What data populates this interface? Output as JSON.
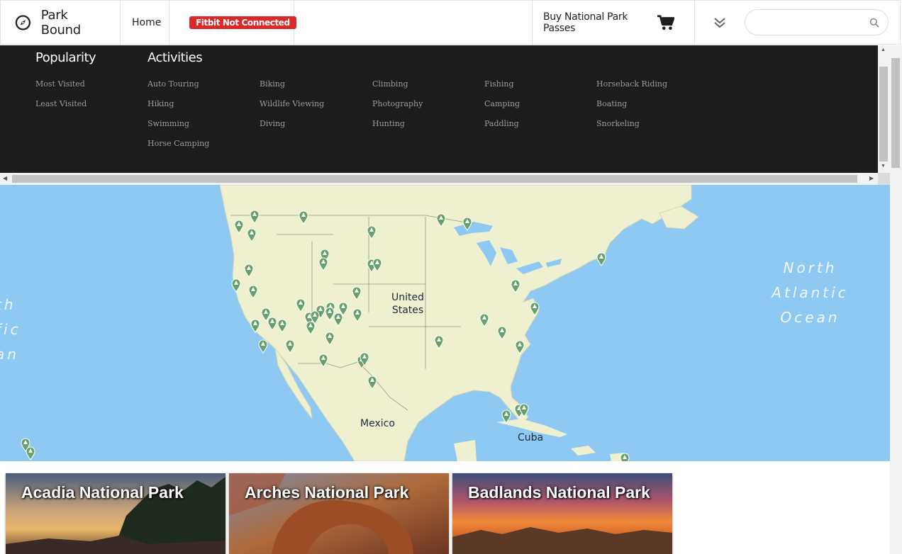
{
  "brand": {
    "name": "Park Bound",
    "logo_icon": "compass-icon"
  },
  "nav": {
    "home": "Home",
    "fitbit_status": "Fitbit Not Connected",
    "passes": "Buy National Park Passes",
    "cart_icon": "shopping-cart-icon",
    "more_icon": "double-chevron-down-icon",
    "search": {
      "value": "",
      "placeholder": "",
      "icon": "search-icon"
    }
  },
  "menu": {
    "popularity": {
      "heading": "Popularity",
      "items": [
        "Most Visited",
        "Least Visited"
      ]
    },
    "activities": {
      "heading": "Activities",
      "items": [
        "Auto Touring",
        "Biking",
        "Climbing",
        "Fishing",
        "Horseback Riding",
        "Hiking",
        "Wildlife Viewing",
        "Photography",
        "Camping",
        "Boating",
        "Swimming",
        "Diving",
        "Hunting",
        "Paddling",
        "Snorkeling",
        "Horse Camping"
      ]
    }
  },
  "map": {
    "labels": {
      "us": "United States",
      "mexico": "Mexico",
      "cuba": "Cuba"
    },
    "ocean_atlantic": [
      "North",
      "Atlantic",
      "Ocean"
    ],
    "ocean_pacific_partial": [
      "th",
      "fic",
      "an"
    ],
    "marker_icon": "park-marker-icon",
    "colors": {
      "water": "#8ec9f3",
      "land": "#eef0cf",
      "marker": "#66a06c"
    }
  },
  "cards": [
    {
      "title": "Acadia National Park"
    },
    {
      "title": "Arches National Park"
    },
    {
      "title": "Badlands National Park"
    }
  ],
  "colors": {
    "menu_bg": "#1b1c1d",
    "badge": "#db2828"
  }
}
